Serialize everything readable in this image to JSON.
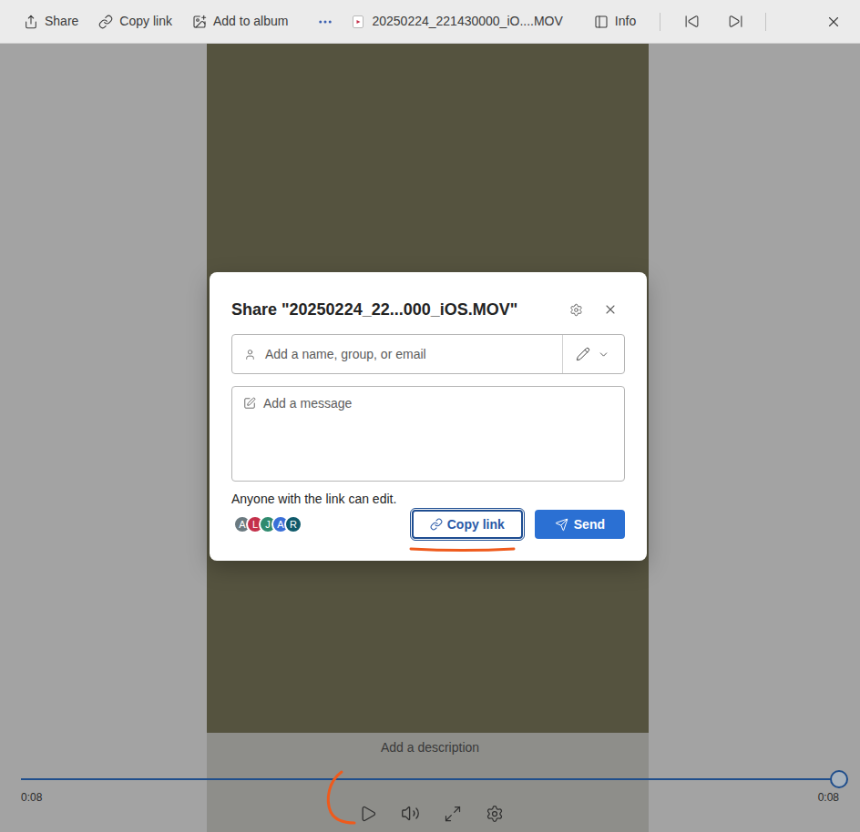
{
  "toolbar": {
    "actions": [
      {
        "label": "Share",
        "kind": "share"
      },
      {
        "label": "Copy link",
        "kind": "link"
      },
      {
        "label": "Add to album",
        "kind": "album"
      }
    ],
    "file_name": "20250224_221430000_iO....MOV",
    "info": "Info"
  },
  "dialog": {
    "title": "Share \"20250224_22...000_iOS.MOV\"",
    "recipient_placeholder": "Add a name, group, or email",
    "message_placeholder": "Add a message",
    "permission": "Anyone with the link can edit.",
    "avatars": [
      {
        "initial": "A",
        "color": "#6b7a80"
      },
      {
        "initial": "L",
        "color": "#c4314b"
      },
      {
        "initial": "J",
        "color": "#2f8a6e"
      },
      {
        "initial": "A",
        "color": "#3a6fd8"
      },
      {
        "initial": "R",
        "color": "#0f5a6b"
      }
    ],
    "buttons": [
      {
        "label": "Copy link",
        "kind": "secondary",
        "focused": true
      },
      {
        "label": "Send",
        "kind": "primary",
        "focused": false
      }
    ]
  },
  "player": {
    "description_placeholder": "Add a description",
    "elapsed": "0:08",
    "duration": "0:08",
    "level": 1,
    "playing": false
  }
}
